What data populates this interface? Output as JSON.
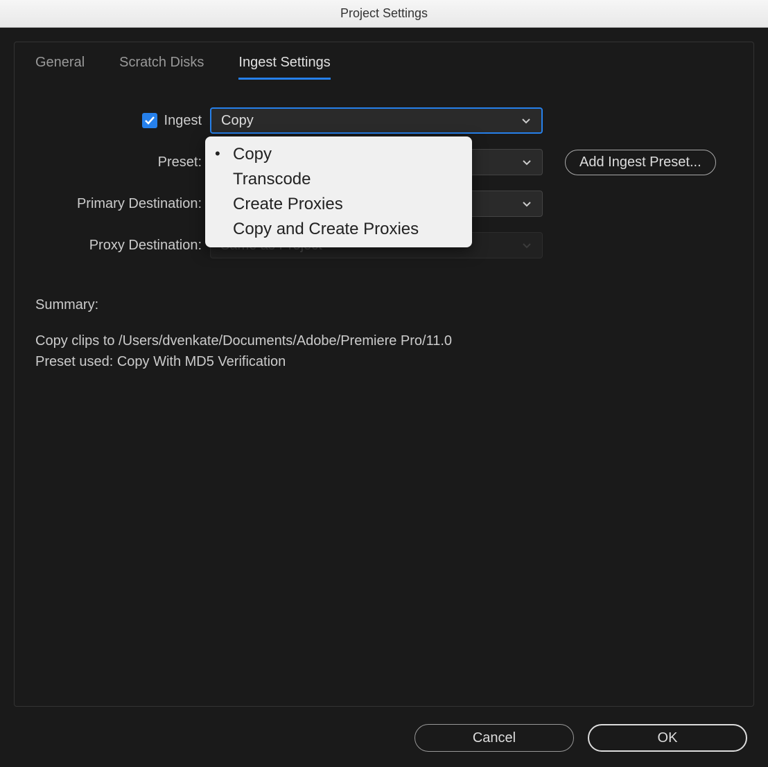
{
  "window": {
    "title": "Project Settings"
  },
  "tabs": {
    "general": "General",
    "scratch_disks": "Scratch Disks",
    "ingest_settings": "Ingest Settings"
  },
  "form": {
    "ingest_label": "Ingest",
    "ingest_dropdown_value": "Copy",
    "preset_label": "Preset:",
    "primary_destination_label": "Primary Destination:",
    "proxy_destination_label": "Proxy Destination:",
    "proxy_destination_value": "Same as Project",
    "add_ingest_preset": "Add Ingest Preset..."
  },
  "ingest_options": [
    "Copy",
    "Transcode",
    "Create Proxies",
    "Copy and Create Proxies"
  ],
  "summary": {
    "title": "Summary:",
    "line1": "Copy clips to /Users/dvenkate/Documents/Adobe/Premiere Pro/11.0",
    "line2": "Preset used: Copy With MD5 Verification"
  },
  "footer": {
    "cancel": "Cancel",
    "ok": "OK"
  }
}
